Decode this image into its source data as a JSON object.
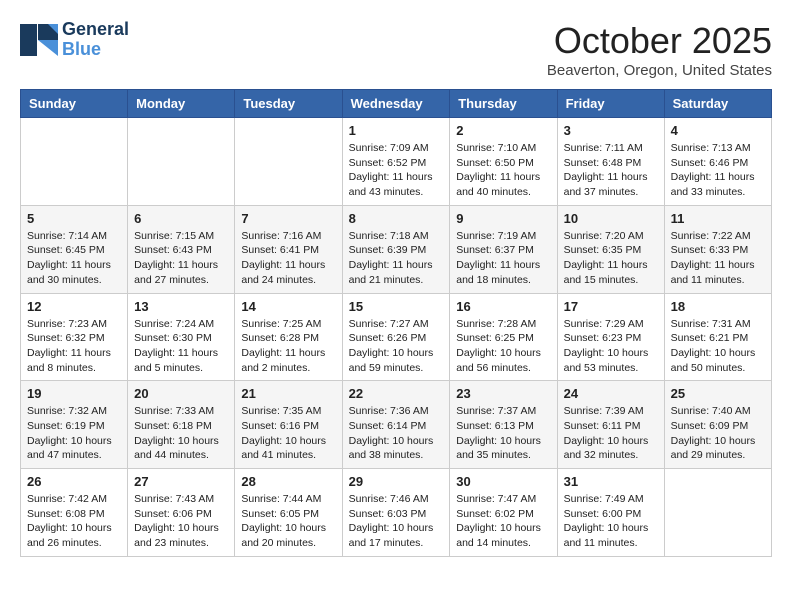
{
  "header": {
    "logo_general": "General",
    "logo_blue": "Blue",
    "month_title": "October 2025",
    "location": "Beaverton, Oregon, United States"
  },
  "days_of_week": [
    "Sunday",
    "Monday",
    "Tuesday",
    "Wednesday",
    "Thursday",
    "Friday",
    "Saturday"
  ],
  "weeks": [
    [
      {
        "day": "",
        "info": ""
      },
      {
        "day": "",
        "info": ""
      },
      {
        "day": "",
        "info": ""
      },
      {
        "day": "1",
        "info": "Sunrise: 7:09 AM\nSunset: 6:52 PM\nDaylight: 11 hours and 43 minutes."
      },
      {
        "day": "2",
        "info": "Sunrise: 7:10 AM\nSunset: 6:50 PM\nDaylight: 11 hours and 40 minutes."
      },
      {
        "day": "3",
        "info": "Sunrise: 7:11 AM\nSunset: 6:48 PM\nDaylight: 11 hours and 37 minutes."
      },
      {
        "day": "4",
        "info": "Sunrise: 7:13 AM\nSunset: 6:46 PM\nDaylight: 11 hours and 33 minutes."
      }
    ],
    [
      {
        "day": "5",
        "info": "Sunrise: 7:14 AM\nSunset: 6:45 PM\nDaylight: 11 hours and 30 minutes."
      },
      {
        "day": "6",
        "info": "Sunrise: 7:15 AM\nSunset: 6:43 PM\nDaylight: 11 hours and 27 minutes."
      },
      {
        "day": "7",
        "info": "Sunrise: 7:16 AM\nSunset: 6:41 PM\nDaylight: 11 hours and 24 minutes."
      },
      {
        "day": "8",
        "info": "Sunrise: 7:18 AM\nSunset: 6:39 PM\nDaylight: 11 hours and 21 minutes."
      },
      {
        "day": "9",
        "info": "Sunrise: 7:19 AM\nSunset: 6:37 PM\nDaylight: 11 hours and 18 minutes."
      },
      {
        "day": "10",
        "info": "Sunrise: 7:20 AM\nSunset: 6:35 PM\nDaylight: 11 hours and 15 minutes."
      },
      {
        "day": "11",
        "info": "Sunrise: 7:22 AM\nSunset: 6:33 PM\nDaylight: 11 hours and 11 minutes."
      }
    ],
    [
      {
        "day": "12",
        "info": "Sunrise: 7:23 AM\nSunset: 6:32 PM\nDaylight: 11 hours and 8 minutes."
      },
      {
        "day": "13",
        "info": "Sunrise: 7:24 AM\nSunset: 6:30 PM\nDaylight: 11 hours and 5 minutes."
      },
      {
        "day": "14",
        "info": "Sunrise: 7:25 AM\nSunset: 6:28 PM\nDaylight: 11 hours and 2 minutes."
      },
      {
        "day": "15",
        "info": "Sunrise: 7:27 AM\nSunset: 6:26 PM\nDaylight: 10 hours and 59 minutes."
      },
      {
        "day": "16",
        "info": "Sunrise: 7:28 AM\nSunset: 6:25 PM\nDaylight: 10 hours and 56 minutes."
      },
      {
        "day": "17",
        "info": "Sunrise: 7:29 AM\nSunset: 6:23 PM\nDaylight: 10 hours and 53 minutes."
      },
      {
        "day": "18",
        "info": "Sunrise: 7:31 AM\nSunset: 6:21 PM\nDaylight: 10 hours and 50 minutes."
      }
    ],
    [
      {
        "day": "19",
        "info": "Sunrise: 7:32 AM\nSunset: 6:19 PM\nDaylight: 10 hours and 47 minutes."
      },
      {
        "day": "20",
        "info": "Sunrise: 7:33 AM\nSunset: 6:18 PM\nDaylight: 10 hours and 44 minutes."
      },
      {
        "day": "21",
        "info": "Sunrise: 7:35 AM\nSunset: 6:16 PM\nDaylight: 10 hours and 41 minutes."
      },
      {
        "day": "22",
        "info": "Sunrise: 7:36 AM\nSunset: 6:14 PM\nDaylight: 10 hours and 38 minutes."
      },
      {
        "day": "23",
        "info": "Sunrise: 7:37 AM\nSunset: 6:13 PM\nDaylight: 10 hours and 35 minutes."
      },
      {
        "day": "24",
        "info": "Sunrise: 7:39 AM\nSunset: 6:11 PM\nDaylight: 10 hours and 32 minutes."
      },
      {
        "day": "25",
        "info": "Sunrise: 7:40 AM\nSunset: 6:09 PM\nDaylight: 10 hours and 29 minutes."
      }
    ],
    [
      {
        "day": "26",
        "info": "Sunrise: 7:42 AM\nSunset: 6:08 PM\nDaylight: 10 hours and 26 minutes."
      },
      {
        "day": "27",
        "info": "Sunrise: 7:43 AM\nSunset: 6:06 PM\nDaylight: 10 hours and 23 minutes."
      },
      {
        "day": "28",
        "info": "Sunrise: 7:44 AM\nSunset: 6:05 PM\nDaylight: 10 hours and 20 minutes."
      },
      {
        "day": "29",
        "info": "Sunrise: 7:46 AM\nSunset: 6:03 PM\nDaylight: 10 hours and 17 minutes."
      },
      {
        "day": "30",
        "info": "Sunrise: 7:47 AM\nSunset: 6:02 PM\nDaylight: 10 hours and 14 minutes."
      },
      {
        "day": "31",
        "info": "Sunrise: 7:49 AM\nSunset: 6:00 PM\nDaylight: 10 hours and 11 minutes."
      },
      {
        "day": "",
        "info": ""
      }
    ]
  ]
}
